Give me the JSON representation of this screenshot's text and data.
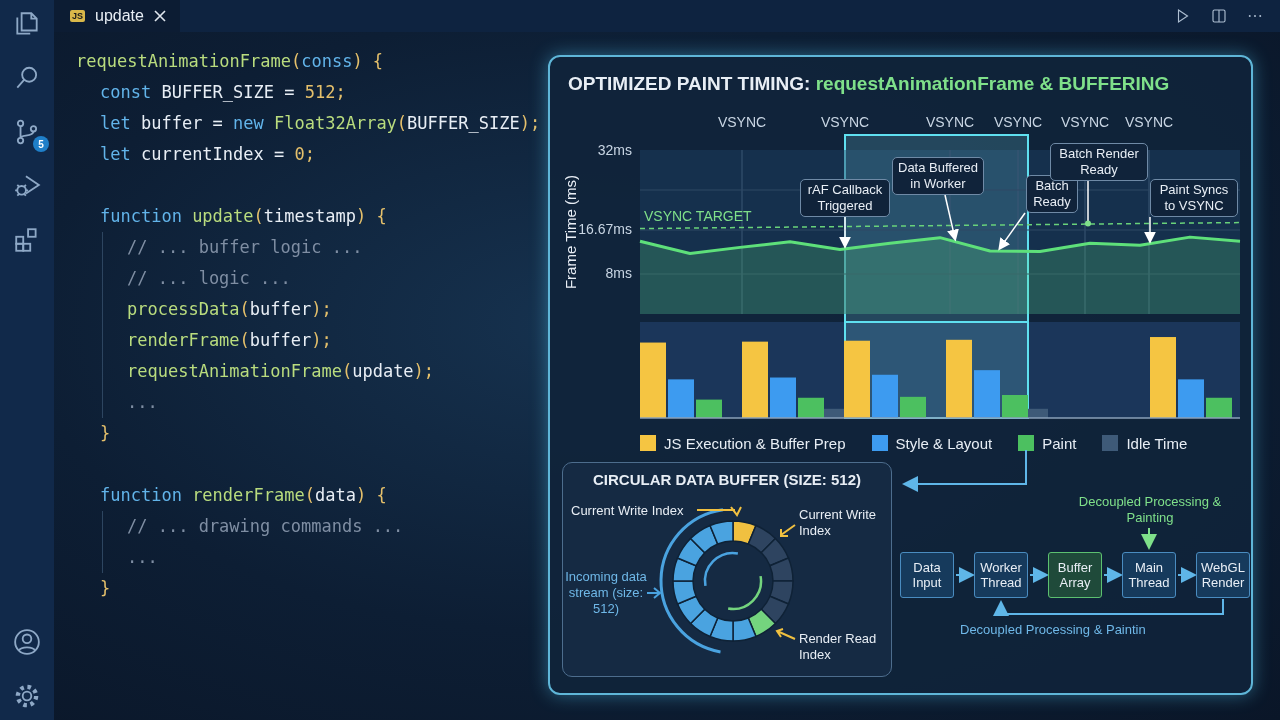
{
  "activity_bar": {
    "top": [
      {
        "kind": "files"
      },
      {
        "kind": "search"
      },
      {
        "kind": "source-control",
        "badge": "5"
      },
      {
        "kind": "run-debug"
      },
      {
        "kind": "extensions"
      }
    ],
    "bottom": [
      {
        "kind": "account"
      },
      {
        "kind": "settings"
      }
    ]
  },
  "tab": {
    "icon_text": "JS",
    "label": "update"
  },
  "editor_actions": [
    {
      "kind": "run"
    },
    {
      "kind": "split"
    },
    {
      "kind": "more"
    }
  ],
  "code": [
    {
      "tokens": [
        {
          "kind": "fn",
          "text": "requestAnimationFrame"
        },
        {
          "kind": "punct",
          "text": "("
        },
        {
          "kind": "param",
          "text": "conss"
        },
        {
          "kind": "punct",
          "text": ") {"
        }
      ],
      "children": [
        {
          "tokens": [
            {
              "kind": "kw",
              "text": "const"
            },
            {
              "kind": "plain",
              "text": " BUFFER_SIZE = "
            },
            {
              "kind": "num",
              "text": "512"
            },
            {
              "kind": "punct",
              "text": ";"
            }
          ]
        },
        {
          "tokens": [
            {
              "kind": "kw",
              "text": "let"
            },
            {
              "kind": "plain",
              "text": " buffer = "
            },
            {
              "kind": "kw",
              "text": "new "
            },
            {
              "kind": "fn",
              "text": "Float32Array"
            },
            {
              "kind": "punct",
              "text": "("
            },
            {
              "kind": "plain",
              "text": "BUFFER_SIZE"
            },
            {
              "kind": "punct",
              "text": ");"
            }
          ]
        },
        {
          "tokens": [
            {
              "kind": "kw",
              "text": "let"
            },
            {
              "kind": "plain",
              "text": " currentIndex = "
            },
            {
              "kind": "num",
              "text": "0"
            },
            {
              "kind": "punct",
              "text": ";"
            }
          ]
        },
        {
          "tokens": [
            {
              "kind": "kw",
              "text": "function "
            },
            {
              "kind": "fn",
              "text": "update"
            },
            {
              "kind": "punct",
              "text": "("
            },
            {
              "kind": "plain",
              "text": "timestamp"
            },
            {
              "kind": "punct",
              "text": ") {"
            }
          ],
          "children": [
            {
              "tokens": [
                {
                  "kind": "comment",
                  "text": "// ... buffer logic ..."
                }
              ]
            },
            {
              "tokens": [
                {
                  "kind": "comment",
                  "text": "// ... logic ..."
                }
              ]
            },
            {
              "tokens": [
                {
                  "kind": "fn",
                  "text": "processData"
                },
                {
                  "kind": "punct",
                  "text": "("
                },
                {
                  "kind": "plain",
                  "text": "buffer"
                },
                {
                  "kind": "punct",
                  "text": ");"
                }
              ]
            },
            {
              "tokens": [
                {
                  "kind": "fn",
                  "text": "renderFrame"
                },
                {
                  "kind": "punct",
                  "text": "("
                },
                {
                  "kind": "plain",
                  "text": "buffer"
                },
                {
                  "kind": "punct",
                  "text": ");"
                }
              ]
            },
            {
              "tokens": [
                {
                  "kind": "fn",
                  "text": "requestAnimationFrame"
                },
                {
                  "kind": "punct",
                  "text": "("
                },
                {
                  "kind": "plain",
                  "text": "update"
                },
                {
                  "kind": "punct",
                  "text": ");"
                }
              ]
            },
            {
              "tokens": [
                {
                  "kind": "comment",
                  "text": "..."
                }
              ]
            }
          ],
          "close": [
            {
              "kind": "punct",
              "text": "}"
            }
          ]
        },
        {
          "tokens": [
            {
              "kind": "kw",
              "text": "function "
            },
            {
              "kind": "fn",
              "text": "renderFrame"
            },
            {
              "kind": "punct",
              "text": "("
            },
            {
              "kind": "plain",
              "text": "data"
            },
            {
              "kind": "punct",
              "text": ") {"
            }
          ],
          "children": [
            {
              "tokens": [
                {
                  "kind": "comment",
                  "text": "// ... drawing commands ..."
                }
              ]
            },
            {
              "tokens": [
                {
                  "kind": "comment",
                  "text": "..."
                }
              ]
            }
          ],
          "close": [
            {
              "kind": "punct",
              "text": "}"
            }
          ]
        }
      ]
    }
  ],
  "panel": {
    "title_parts": [
      {
        "kind": "plain",
        "text": "OPTIMIZED PAINT TIMING: "
      },
      {
        "kind": "accent",
        "text": "requestAnimationFrame & BUFFERING"
      }
    ],
    "vsync_labels": [
      "VSYNC",
      "VSYNC",
      "VSYNC",
      "VSYNC",
      "VSYNC",
      "VSYNC"
    ],
    "chart_data": {
      "type": "line",
      "ylabel": "Frame Time (ms)",
      "categories": [
        null,
        null,
        null,
        null,
        null,
        null,
        null,
        null,
        null,
        null,
        null,
        null,
        null
      ],
      "ylim": [
        0,
        32
      ],
      "yticks": [
        {
          "value": 8,
          "label": "8ms"
        },
        {
          "value": 16.67,
          "label": "16.67ms"
        },
        {
          "value": 32,
          "label": "32ms"
        }
      ],
      "series": [
        {
          "color": "#5ee07a",
          "values": [
            14.2,
            11.8,
            13,
            14.1,
            12.6,
            13.8,
            14.9,
            12.3,
            12.2,
            13.8,
            13.4,
            15,
            14.2
          ]
        }
      ],
      "annotations": [
        "VSYNC TARGET"
      ]
    },
    "callouts": [
      {
        "text": "rAF Callback Triggered"
      },
      {
        "text": "Data Buffered in Worker"
      },
      {
        "text": "Batch Ready"
      },
      {
        "text": "Batch Render Ready"
      },
      {
        "text": "Paint Syncs to VSYNC"
      }
    ],
    "legend": [
      {
        "label": "JS Execution & Buffer Prep",
        "color": "#f5c542"
      },
      {
        "label": "Style & Layout",
        "color": "#3d9bf0"
      },
      {
        "label": "Paint",
        "color": "#4cc060"
      },
      {
        "label": "Idle Time",
        "color": "#3e5a78"
      }
    ],
    "buffer_card": {
      "title": "CIRCULAR DATA BUFFER (SIZE: 512)",
      "labels": [
        {
          "text": "Current Write Index"
        },
        {
          "text": "Current Write Index"
        },
        {
          "text": "Incoming data stream (size: 512)"
        },
        {
          "text": "Render Read Index"
        }
      ]
    },
    "pipeline": {
      "top_label": "Decoupled Processing & Painting",
      "stages": [
        {
          "kind": "stage",
          "label": "Data Input"
        },
        {
          "kind": "stage",
          "label": "Worker Thread"
        },
        {
          "kind": "buffer",
          "label": "Buffer Array"
        },
        {
          "kind": "stage",
          "label": "Main Thread"
        },
        {
          "kind": "stage",
          "label": "WebGL Render"
        }
      ],
      "bottom_label": "Decoupled Processing & Paintin"
    }
  }
}
